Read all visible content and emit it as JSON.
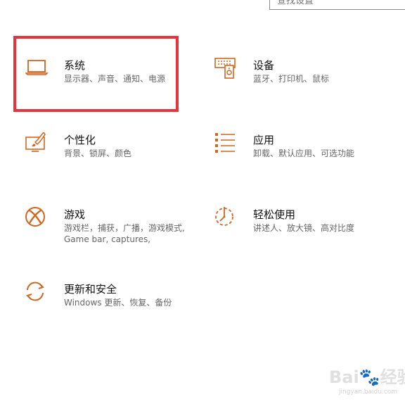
{
  "search": {
    "placeholder": "查找设置"
  },
  "accent_color": "#d2651f",
  "highlight_color": "#e8333b",
  "tiles": [
    {
      "title": "系统",
      "desc": [
        "显示器、声音、通知、电源"
      ],
      "icon": "laptop-icon"
    },
    {
      "title": "设备",
      "desc": [
        "蓝牙、打印机、鼠标"
      ],
      "icon": "devices-icon"
    },
    {
      "title": "个性化",
      "desc": [
        "背景、锁屏、颜色"
      ],
      "icon": "personalization-icon"
    },
    {
      "title": "应用",
      "desc": [
        "卸载、默认应用、可选功能"
      ],
      "icon": "apps-icon"
    },
    {
      "title": "游戏",
      "desc": [
        "游戏栏，捕获，广播，游戏模式,",
        "Game bar, captures,"
      ],
      "icon": "xbox-icon"
    },
    {
      "title": "轻松使用",
      "desc": [
        "讲述人、放大镜、高对比度"
      ],
      "icon": "ease-of-access-icon"
    },
    {
      "title": "更新和安全",
      "desc": [
        "Windows 更新、恢复、备份"
      ],
      "icon": "update-icon"
    }
  ],
  "watermark": {
    "main": "Bai🐾经验",
    "sub": "jingyan.baidu.com"
  }
}
